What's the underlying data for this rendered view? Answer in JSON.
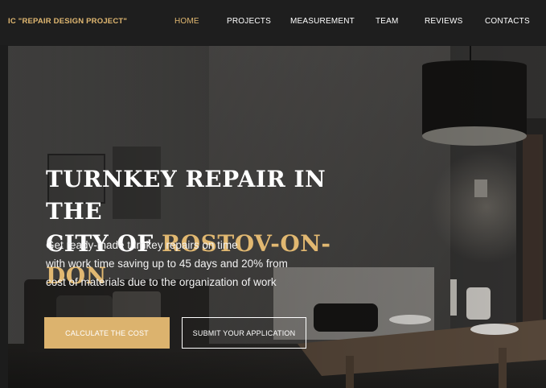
{
  "header": {
    "logo": "IC \"REPAIR DESIGN PROJECT\"",
    "nav": [
      {
        "label": "HOME",
        "active": true
      },
      {
        "label": "PROJECTS",
        "active": false
      },
      {
        "label": "MEASUREMENT",
        "active": false
      },
      {
        "label": "TEAM",
        "active": false
      },
      {
        "label": "REVIEWS",
        "active": false
      },
      {
        "label": "CONTACTS",
        "active": false
      }
    ]
  },
  "hero": {
    "title_line1": "TURNKEY REPAIR IN THE",
    "title_line2_prefix": "CITY OF ",
    "title_line2_accent": "ROSTOV-ON-DON",
    "desc_line1": "Get ready-made turnkey repairs on time",
    "desc_line2": "with work time saving up to 45 days and 20% from",
    "desc_line3": "cost of materials due to the organization of work",
    "primary_button": "CALCULATE THE COST",
    "secondary_button": "SUBMIT YOUR APPLICATION"
  },
  "colors": {
    "accent": "#e1b871",
    "header_bg": "#1e1e1e",
    "button_primary": "#dcb36e"
  }
}
